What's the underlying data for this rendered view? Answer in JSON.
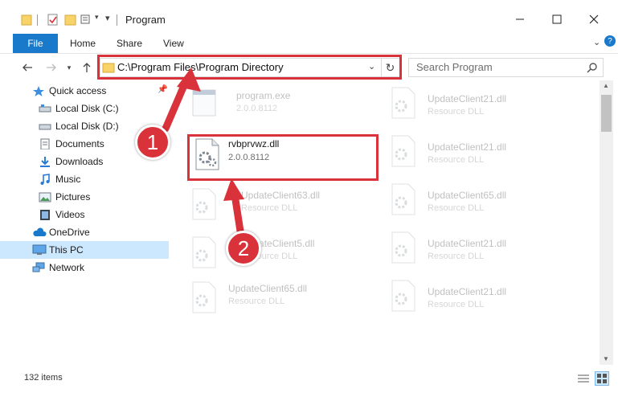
{
  "window": {
    "title": "Program"
  },
  "ribbon": {
    "file": "File",
    "tabs": [
      "Home",
      "Share",
      "View"
    ]
  },
  "address": {
    "path": "C:\\Program Files\\Program Directory"
  },
  "search": {
    "placeholder": "Search Program"
  },
  "sidebar": {
    "items": [
      "Quick access",
      "Local Disk (C:)",
      "Local Disk (D:)",
      "Documents",
      "Downloads",
      "Music",
      "Pictures",
      "Videos",
      "OneDrive",
      "This PC",
      "Network"
    ]
  },
  "files": {
    "left": [
      {
        "name": "program.exe",
        "sub": "2.0.0.8112"
      },
      {
        "name": "rvbprvwz.dll",
        "sub": "2.0.0.8112"
      },
      {
        "name": "UpdateClient63.dll",
        "sub": "Resource DLL"
      },
      {
        "name": "UpdateClient5.dll",
        "sub": "Resource DLL"
      },
      {
        "name": "UpdateClient65.dll",
        "sub": "Resource DLL"
      }
    ],
    "right": [
      {
        "name": "UpdateClient21.dll",
        "sub": "Resource DLL"
      },
      {
        "name": "UpdateClient21.dll",
        "sub": "Resource DLL"
      },
      {
        "name": "UpdateClient65.dll",
        "sub": "Resource DLL"
      },
      {
        "name": "UpdateClient21.dll",
        "sub": "Resource DLL"
      },
      {
        "name": "UpdateClient21.dll",
        "sub": "Resource DLL"
      }
    ]
  },
  "status": {
    "count": "132 items"
  },
  "annotations": {
    "badge1": "1",
    "badge2": "2"
  },
  "colors": {
    "accent": "#1979ca",
    "annotation": "#d9323a",
    "selected": "#cce8ff"
  }
}
